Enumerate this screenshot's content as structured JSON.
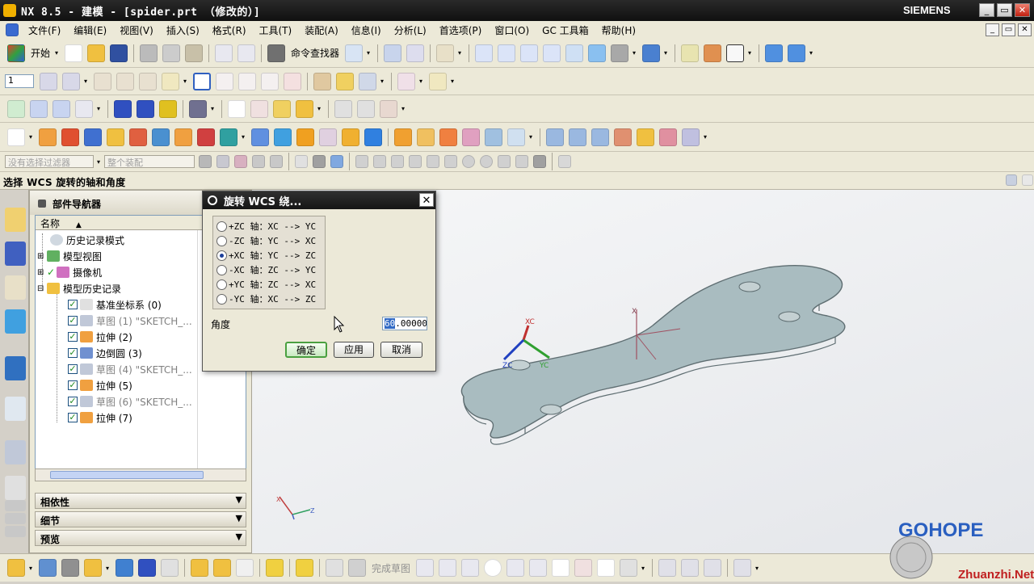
{
  "window": {
    "title": "NX 8.5 - 建模 - [spider.prt （修改的）]",
    "brand": "SIEMENS",
    "controls": [
      "_",
      "▭",
      "✕"
    ]
  },
  "menu": {
    "items": [
      "文件(F)",
      "编辑(E)",
      "视图(V)",
      "插入(S)",
      "格式(R)",
      "工具(T)",
      "装配(A)",
      "信息(I)",
      "分析(L)",
      "首选项(P)",
      "窗口(O)",
      "GC 工具箱",
      "帮助(H)"
    ]
  },
  "toolbar": {
    "start_label": "开始",
    "command_finder_label": "命令查找器",
    "layer_value": "1",
    "filter_placeholder": "没有选择过滤器",
    "assembly_filter": "整个装配"
  },
  "status": {
    "prompt": "选择 WCS 旋转的轴和角度"
  },
  "navigator": {
    "title": "部件导航器",
    "column_name": "名称",
    "items": [
      {
        "label": "历史记录模式",
        "gray": false
      },
      {
        "label": "模型视图",
        "gray": false
      },
      {
        "label": "摄像机",
        "gray": false
      },
      {
        "label": "模型历史记录",
        "gray": false
      },
      {
        "label": "基准坐标系 (0)",
        "gray": false
      },
      {
        "label": "草图 (1) \"SKETCH_...",
        "gray": true
      },
      {
        "label": "拉伸 (2)",
        "gray": false
      },
      {
        "label": "边倒圆 (3)",
        "gray": false
      },
      {
        "label": "草图 (4) \"SKETCH_...",
        "gray": true
      },
      {
        "label": "拉伸 (5)",
        "gray": false
      },
      {
        "label": "草图 (6) \"SKETCH_...",
        "gray": true
      },
      {
        "label": "拉伸 (7)",
        "gray": false
      }
    ],
    "panels": [
      "相依性",
      "细节",
      "预览"
    ]
  },
  "dialog": {
    "title": "旋转 WCS 绕...",
    "options": [
      "+ZC 轴：XC --> YC",
      "-ZC 轴：YC --> XC",
      "+XC 轴：YC --> ZC",
      "-XC 轴：ZC --> YC",
      "+YC 轴：ZC --> XC",
      "-YC 轴：XC --> ZC"
    ],
    "selected_index": 2,
    "angle_label": "角度",
    "angle_selected": "60",
    "angle_rest": ".00000",
    "ok_label": "确定",
    "apply_label": "应用",
    "cancel_label": "取消"
  },
  "viewport": {
    "axis_labels": {
      "x": "XC",
      "y": "YC",
      "z": "ZC"
    },
    "triad_labels": {
      "x": "X",
      "z": "Z"
    },
    "model_color": "#a9bcc0"
  },
  "bottombar": {
    "finish_sketch_label": "完成草图"
  },
  "watermark": {
    "text": "GOHOPE",
    "site": "Zhuanzhi.Net"
  }
}
